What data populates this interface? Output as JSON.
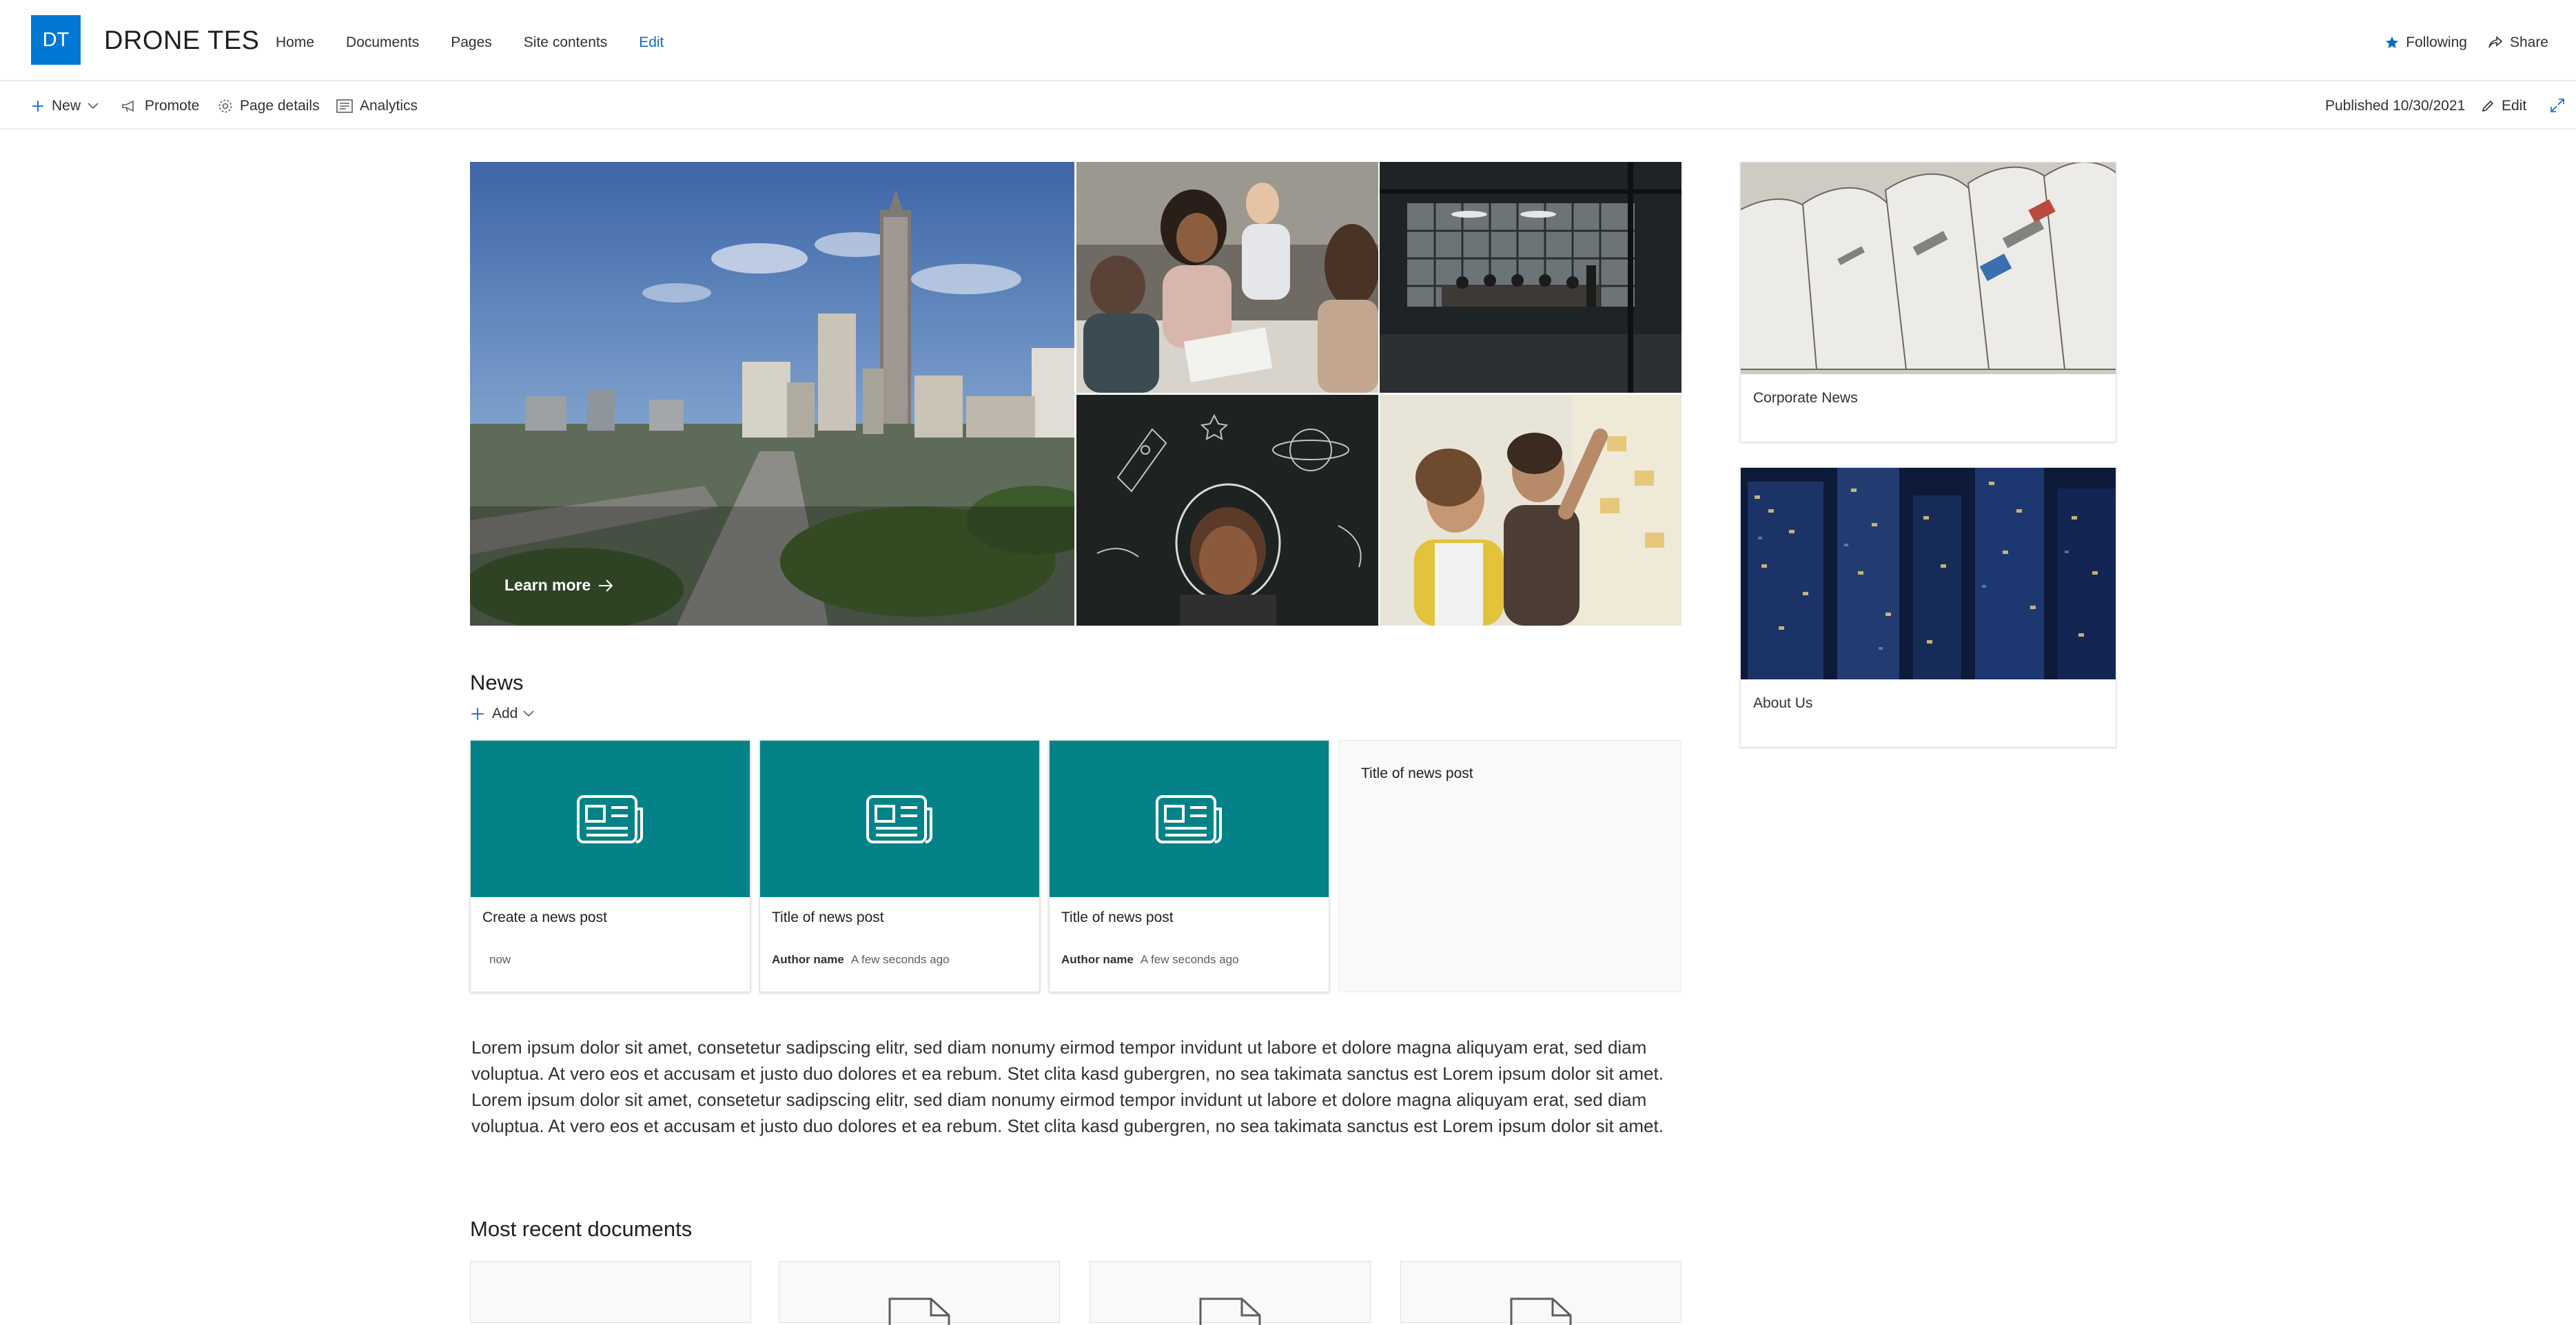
{
  "header": {
    "logo_initials": "DT",
    "site_title": "DRONE TES",
    "nav": [
      "Home",
      "Documents",
      "Pages",
      "Site contents",
      "Edit"
    ],
    "following_label": "Following",
    "share_label": "Share"
  },
  "command_bar": {
    "new_label": "New",
    "promote_label": "Promote",
    "page_details_label": "Page details",
    "analytics_label": "Analytics",
    "published_label": "Published 10/30/2021",
    "edit_label": "Edit"
  },
  "hero": {
    "learn_more_label": "Learn more"
  },
  "news": {
    "title": "News",
    "add_label": "Add",
    "cards": [
      {
        "title": "Create a news post",
        "author": "",
        "time": "now"
      },
      {
        "title": "Title of news post",
        "author": "Author name",
        "time": "A few seconds ago"
      },
      {
        "title": "Title of news post",
        "author": "Author name",
        "time": "A few seconds ago"
      },
      {
        "title": "Title of news post"
      }
    ]
  },
  "body_text": "Lorem ipsum dolor sit amet, consetetur sadipscing elitr, sed diam nonumy eirmod tempor invidunt ut labore et dolore magna aliquyam erat, sed diam voluptua. At vero eos et accusam et justo duo dolores et ea rebum. Stet clita kasd gubergren, no sea takimata sanctus est Lorem ipsum dolor sit amet. Lorem ipsum dolor sit amet, consetetur sadipscing elitr, sed diam nonumy eirmod tempor invidunt ut labore et dolore magna aliquyam erat, sed diam voluptua. At vero eos et accusam et justo duo dolores et ea rebum. Stet clita kasd gubergren, no sea takimata sanctus est Lorem ipsum dolor sit amet.",
  "recent_documents": {
    "title": "Most recent documents"
  },
  "quick_links": [
    {
      "label": "Corporate News"
    },
    {
      "label": "About Us"
    }
  ],
  "colors": {
    "brand": "#0078d4",
    "news_teal": "#038387"
  }
}
